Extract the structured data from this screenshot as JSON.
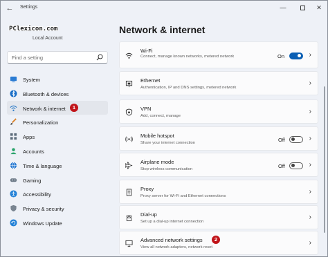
{
  "window": {
    "title": "Settings",
    "back_glyph": "←",
    "minimize_glyph": "—",
    "close_glyph": "✕"
  },
  "profile": {
    "logo_text": "PClexicon.com",
    "account_label": "Local Account"
  },
  "search": {
    "placeholder": "Find a setting"
  },
  "nav": {
    "items": [
      {
        "label": "System",
        "icon": "system-icon",
        "color": "#2b7cd3"
      },
      {
        "label": "Bluetooth & devices",
        "icon": "bluetooth-icon",
        "color": "#1a6fc7"
      },
      {
        "label": "Network & internet",
        "icon": "wifi-icon",
        "color": "#1e72c4",
        "active": true,
        "badge": "1"
      },
      {
        "label": "Personalization",
        "icon": "brush-icon",
        "color": "#d9822b"
      },
      {
        "label": "Apps",
        "icon": "apps-icon",
        "color": "#5b6b7a"
      },
      {
        "label": "Accounts",
        "icon": "accounts-icon",
        "color": "#2aa36b"
      },
      {
        "label": "Time & language",
        "icon": "globe-clock-icon",
        "color": "#2b7cd3"
      },
      {
        "label": "Gaming",
        "icon": "gamepad-icon",
        "color": "#6b7886"
      },
      {
        "label": "Accessibility",
        "icon": "accessibility-icon",
        "color": "#1f7fd6"
      },
      {
        "label": "Privacy & security",
        "icon": "shield-icon",
        "color": "#7a8591"
      },
      {
        "label": "Windows Update",
        "icon": "update-icon",
        "color": "#1f7fd6"
      }
    ]
  },
  "main": {
    "title": "Network & internet",
    "cards": [
      {
        "title": "Wi-Fi",
        "subtitle": "Connect, manage known networks, metered network",
        "icon": "wifi-icon",
        "toggle": true,
        "state": "On",
        "on": true
      },
      {
        "title": "Ethernet",
        "subtitle": "Authentication, IP and DNS settings, metered network",
        "icon": "ethernet-icon"
      },
      {
        "title": "VPN",
        "subtitle": "Add, connect, manage",
        "icon": "vpn-shield-icon"
      },
      {
        "title": "Mobile hotspot",
        "subtitle": "Share your internet connection",
        "icon": "hotspot-icon",
        "toggle": true,
        "state": "Off",
        "on": false
      },
      {
        "title": "Airplane mode",
        "subtitle": "Stop wireless communication",
        "icon": "airplane-icon",
        "toggle": true,
        "state": "Off",
        "on": false
      },
      {
        "title": "Proxy",
        "subtitle": "Proxy server for Wi-Fi and Ethernet connections",
        "icon": "proxy-icon"
      },
      {
        "title": "Dial-up",
        "subtitle": "Set up a dial-up internet connection",
        "icon": "dialup-icon"
      },
      {
        "title": "Advanced network settings",
        "subtitle": "View all network adapters, network reset",
        "icon": "network-monitor-icon",
        "badge": "2"
      }
    ],
    "chevron_glyph": "›"
  },
  "colors": {
    "accent": "#0a5fb4",
    "badge": "#c1141a",
    "active_nav": "#e3e6ec"
  }
}
